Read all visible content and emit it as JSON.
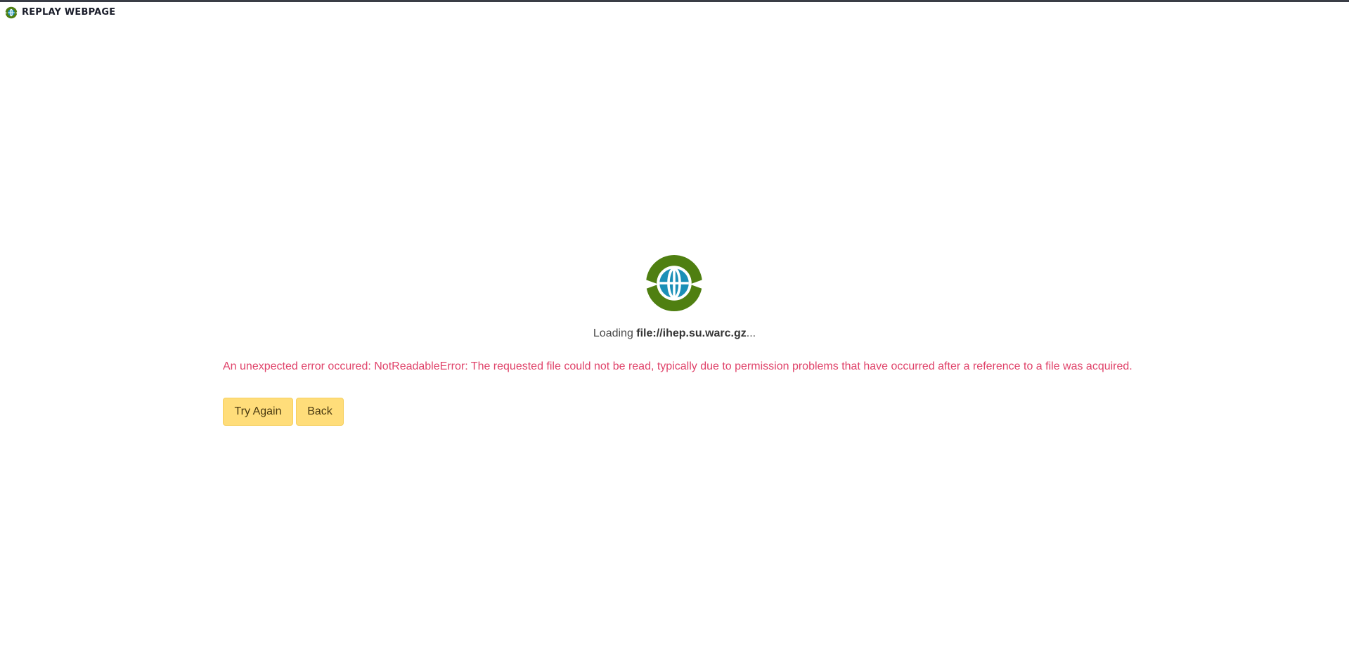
{
  "header": {
    "title": "REPLAY WEBPAGE",
    "logo_icon": "replay-globe-logo-icon"
  },
  "loading": {
    "prefix": "Loading ",
    "file_name": "file://ihep.su.warc.gz",
    "suffix": "..."
  },
  "error": {
    "message": "An unexpected error occured: NotReadableError: The requested file could not be read, typically due to permission problems that have occurred after a reference to a file was acquired."
  },
  "actions": {
    "try_again_label": "Try Again",
    "back_label": "Back"
  },
  "colors": {
    "brand_green": "#4f7f11",
    "globe_blue": "#1a8fb7",
    "error_pink": "#e0436a",
    "button_yellow": "#ffdd7a"
  }
}
